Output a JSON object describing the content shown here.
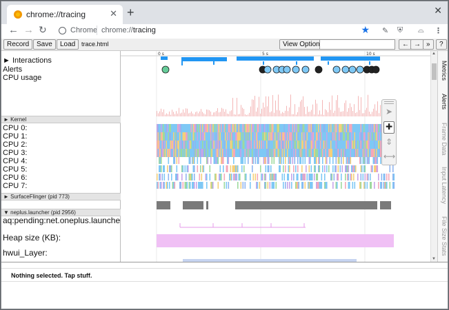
{
  "tab": {
    "title": "chrome://tracing"
  },
  "omnibox": {
    "scheme_label": "Chrome",
    "url_prefix": "chrome://",
    "url_host": "tracing"
  },
  "controls": {
    "record": "Record",
    "save": "Save",
    "load": "Load",
    "filename": "trace.html",
    "view_options": "View Options",
    "nav_prev": "←",
    "nav_next": "→",
    "nav_all": "»",
    "help": "?"
  },
  "timeline": {
    "ticks": [
      "0 s",
      "5 s",
      "10 s"
    ]
  },
  "tracks": {
    "interactions": "Interactions",
    "alerts": "Alerts",
    "cpu_usage": "CPU usage",
    "kernel": "Kernel",
    "cpus": [
      "CPU 0:",
      "CPU 1:",
      "CPU 2:",
      "CPU 3:",
      "CPU 4:",
      "CPU 5:",
      "CPU 6:",
      "CPU 7:"
    ],
    "surfaceflinger": "SurfaceFlinger (pid 773)",
    "launcher": "neplus.launcher (pid 2956)",
    "aq_pending": "aq:pending:net.oneplus.launche…",
    "heap": "Heap size (KB):",
    "hwui": "hwui_Layer:"
  },
  "side_tabs": [
    "Metrics",
    "Alerts",
    "Frame Data",
    "Input Latency",
    "File Size Stats"
  ],
  "status": {
    "message": "Nothing selected. Tap stuff."
  },
  "colors": {
    "interaction": "#2196f3",
    "cpu_usage": "#f4b6b6",
    "cpu_blue": "#7ec8f5",
    "surfaceflinger": "#7a7a7a",
    "heap": "#f0c0f5"
  }
}
